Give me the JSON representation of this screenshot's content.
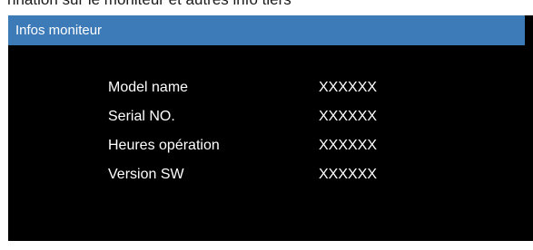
{
  "caption": "nnation sur le moniteur et autres info tiers",
  "window": {
    "title": "Infos moniteur",
    "rows": [
      {
        "label": "Model name",
        "value": "XXXXXX"
      },
      {
        "label": "Serial NO.",
        "value": "XXXXXX"
      },
      {
        "label": "Heures opération",
        "value": "XXXXXX"
      },
      {
        "label": "Version SW",
        "value": "XXXXXX"
      }
    ]
  },
  "colors": {
    "title_bar": "#3d7ab8",
    "panel_background": "#000000",
    "text": "#ffffff"
  }
}
